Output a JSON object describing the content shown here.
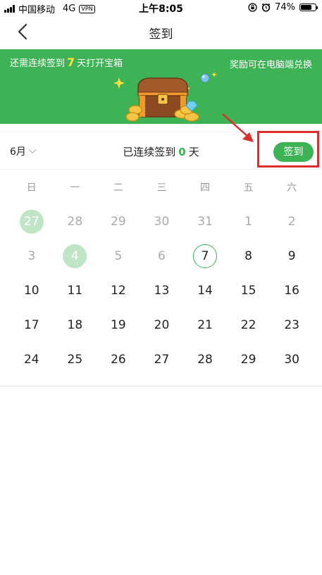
{
  "status_bar": {
    "carrier": "中国移动",
    "network": "4G",
    "vpn": "VPN",
    "time": "上午8:05",
    "battery": "74%",
    "battery_level": 0.74
  },
  "nav": {
    "title": "签到",
    "back_icon": "chevron-left-icon"
  },
  "banner": {
    "left_prefix": "还需连续签到",
    "left_days": "7",
    "left_suffix": "天打开宝箱",
    "right_text": "奖励可在电脑端兑换",
    "background": "#3db356",
    "highlight_color": "#ffe13a"
  },
  "sign_row": {
    "month": "6月",
    "streak_prefix": "已连续签到",
    "streak_count": "0",
    "streak_suffix": "天",
    "sign_button": "签到",
    "annotation_color": "#e12c2c"
  },
  "calendar": {
    "weekdays": [
      "日",
      "一",
      "二",
      "三",
      "四",
      "五",
      "六"
    ],
    "weeks": [
      [
        {
          "d": "27",
          "s": "other signed"
        },
        {
          "d": "28",
          "s": "other"
        },
        {
          "d": "29",
          "s": "other"
        },
        {
          "d": "30",
          "s": "other"
        },
        {
          "d": "31",
          "s": "other"
        },
        {
          "d": "1",
          "s": "other"
        },
        {
          "d": "2",
          "s": "other"
        }
      ],
      [
        {
          "d": "3",
          "s": "other"
        },
        {
          "d": "4",
          "s": "other signed"
        },
        {
          "d": "5",
          "s": "other"
        },
        {
          "d": "6",
          "s": "other"
        },
        {
          "d": "7",
          "s": "today"
        },
        {
          "d": "8",
          "s": ""
        },
        {
          "d": "9",
          "s": ""
        }
      ],
      [
        {
          "d": "10",
          "s": ""
        },
        {
          "d": "11",
          "s": ""
        },
        {
          "d": "12",
          "s": ""
        },
        {
          "d": "13",
          "s": ""
        },
        {
          "d": "14",
          "s": ""
        },
        {
          "d": "15",
          "s": ""
        },
        {
          "d": "16",
          "s": ""
        }
      ],
      [
        {
          "d": "17",
          "s": ""
        },
        {
          "d": "18",
          "s": ""
        },
        {
          "d": "19",
          "s": ""
        },
        {
          "d": "20",
          "s": ""
        },
        {
          "d": "21",
          "s": ""
        },
        {
          "d": "22",
          "s": ""
        },
        {
          "d": "23",
          "s": ""
        }
      ],
      [
        {
          "d": "24",
          "s": ""
        },
        {
          "d": "25",
          "s": ""
        },
        {
          "d": "26",
          "s": ""
        },
        {
          "d": "27",
          "s": ""
        },
        {
          "d": "28",
          "s": ""
        },
        {
          "d": "29",
          "s": ""
        },
        {
          "d": "30",
          "s": ""
        }
      ]
    ]
  }
}
